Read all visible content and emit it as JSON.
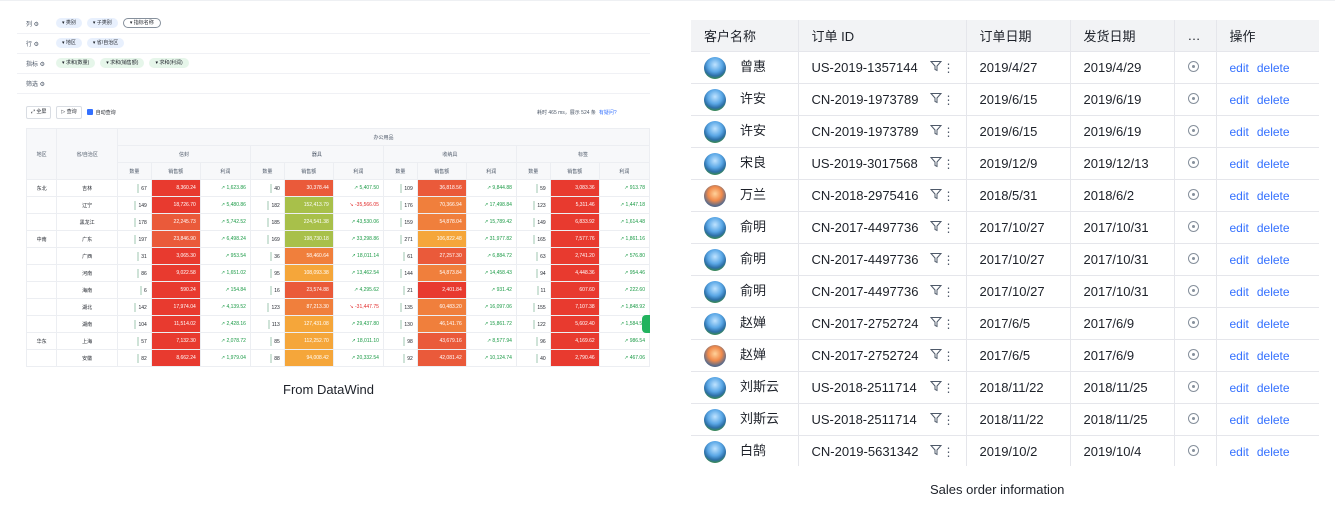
{
  "left_panel": {
    "config_rows": [
      {
        "label": "列 ⚙",
        "pills": [
          {
            "text": "▾ 类别",
            "style": "blue"
          },
          {
            "text": "▾ 子类别",
            "style": "blue"
          },
          {
            "text": "▾ 指标名称",
            "style": "outline"
          }
        ]
      },
      {
        "label": "行 ⚙",
        "pills": [
          {
            "text": "▾ 地区",
            "style": "blue"
          },
          {
            "text": "▾ 省/自治区",
            "style": "blue"
          }
        ]
      },
      {
        "label": "指标 ⚙",
        "pills": [
          {
            "text": "▾ 求和(数量)",
            "style": "green"
          },
          {
            "text": "▾ 求和(销售额)",
            "style": "green"
          },
          {
            "text": "▾ 求和(利润)",
            "style": "green"
          }
        ]
      },
      {
        "label": "筛选 ⚙",
        "pills": []
      }
    ],
    "toolbar": {
      "fullscreen_label": "⤢ 全屏",
      "query_label": "▷ 查询",
      "auto_query_label": "自动查询",
      "status_text": "耗时 465 ms，展示 524 条",
      "help_link": "有疑问?"
    },
    "pivot": {
      "top_header": "办公用品",
      "row_headers": [
        "地区",
        "省/自治区"
      ],
      "subcategories": [
        "信封",
        "器具",
        "收纳具",
        "标签"
      ],
      "metrics": [
        "数量",
        "销售额",
        "利润"
      ],
      "rows": [
        {
          "region": "东北",
          "province": "吉林",
          "cells": [
            [
              "67",
              "8,360.24",
              "↗ 1,623.86"
            ],
            [
              "40",
              "30,378.44",
              "↗ 5,407.50"
            ],
            [
              "109",
              "36,818.56",
              "↗ 9,844.88"
            ],
            [
              "59",
              "3,083.36",
              "↗ 913.78"
            ]
          ]
        },
        {
          "region": "",
          "province": "辽宁",
          "cells": [
            [
              "149",
              "18,726.70",
              "↗ 5,480.86"
            ],
            [
              "182",
              "152,413.79",
              "↘ -35,566.05"
            ],
            [
              "176",
              "70,366.94",
              "↗ 17,498.84"
            ],
            [
              "123",
              "5,311.46",
              "↗ 1,447.18"
            ]
          ]
        },
        {
          "region": "",
          "province": "黑龙江",
          "cells": [
            [
              "178",
              "22,245.73",
              "↗ 5,742.52"
            ],
            [
              "185",
              "224,541.38",
              "↗ 43,530.06"
            ],
            [
              "159",
              "54,878.04",
              "↗ 15,789.42"
            ],
            [
              "149",
              "6,833.92",
              "↗ 1,614.48"
            ]
          ]
        },
        {
          "region": "中南",
          "province": "广东",
          "cells": [
            [
              "197",
              "23,846.90",
              "↗ 6,498.24"
            ],
            [
              "169",
              "198,730.18",
              "↗ 33,298.86"
            ],
            [
              "271",
              "106,822.48",
              "↗ 31,977.82"
            ],
            [
              "165",
              "7,577.76",
              "↗ 1,861.16"
            ]
          ]
        },
        {
          "region": "",
          "province": "广西",
          "cells": [
            [
              "31",
              "3,065.30",
              "↗ 953.54"
            ],
            [
              "36",
              "58,460.64",
              "↗ 18,011.14"
            ],
            [
              "61",
              "27,257.30",
              "↗ 6,884.72"
            ],
            [
              "63",
              "2,741.20",
              "↗ 576.80"
            ]
          ]
        },
        {
          "region": "",
          "province": "河南",
          "cells": [
            [
              "86",
              "9,022.58",
              "↗ 1,651.02"
            ],
            [
              "95",
              "108,093.38",
              "↗ 13,462.54"
            ],
            [
              "144",
              "54,873.84",
              "↗ 14,458.43"
            ],
            [
              "94",
              "4,448.36",
              "↗ 954.46"
            ]
          ]
        },
        {
          "region": "",
          "province": "海南",
          "cells": [
            [
              "6",
              "590.24",
              "↗ 154.84"
            ],
            [
              "16",
              "23,574.88",
              "↗ 4,295.62"
            ],
            [
              "21",
              "2,401.84",
              "↗ 931.42"
            ],
            [
              "11",
              "607.60",
              "↗ 222.60"
            ]
          ]
        },
        {
          "region": "",
          "province": "湖北",
          "cells": [
            [
              "142",
              "17,974.04",
              "↗ 4,139.52"
            ],
            [
              "123",
              "87,213.30",
              "↘ -31,447.75"
            ],
            [
              "135",
              "60,483.20",
              "↗ 16,097.06"
            ],
            [
              "155",
              "7,107.38",
              "↗ 1,848.92"
            ]
          ]
        },
        {
          "region": "",
          "province": "湖南",
          "cells": [
            [
              "104",
              "11,514.02",
              "↗ 2,428.16"
            ],
            [
              "113",
              "127,431.08",
              "↗ 29,437.80"
            ],
            [
              "130",
              "46,141.76",
              "↗ 15,861.72"
            ],
            [
              "122",
              "5,602.40",
              "↗ 1,584.52"
            ]
          ]
        },
        {
          "region": "华东",
          "province": "上海",
          "cells": [
            [
              "57",
              "7,132.30",
              "↗ 2,078.72"
            ],
            [
              "85",
              "112,252.70",
              "↗ 18,011.10"
            ],
            [
              "98",
              "43,679.16",
              "↗ 8,577.94"
            ],
            [
              "96",
              "4,169.62",
              "↗ 986.54"
            ]
          ]
        },
        {
          "region": "",
          "province": "安徽",
          "cells": [
            [
              "82",
              "8,662.24",
              "↗ 1,979.04"
            ],
            [
              "88",
              "94,008.42",
              "↗ 20,332.54"
            ],
            [
              "92",
              "42,081.42",
              "↗ 10,124.74"
            ],
            [
              "40",
              "2,790.46",
              "↗ 467.06"
            ]
          ]
        }
      ]
    },
    "caption": "From DataWind"
  },
  "right_panel": {
    "columns": [
      "客户名称",
      "订单 ID",
      "订单日期",
      "发货日期",
      "…",
      "操作"
    ],
    "rows": [
      {
        "name": "曾惠",
        "order_id": "US-2019-1357144",
        "order_date": "2019/4/27",
        "ship_date": "2019/4/29",
        "avatar": "sky"
      },
      {
        "name": "许安",
        "order_id": "CN-2019-1973789",
        "order_date": "2019/6/15",
        "ship_date": "2019/6/19",
        "avatar": "sky"
      },
      {
        "name": "许安",
        "order_id": "CN-2019-1973789",
        "order_date": "2019/6/15",
        "ship_date": "2019/6/19",
        "avatar": "sky"
      },
      {
        "name": "宋良",
        "order_id": "US-2019-3017568",
        "order_date": "2019/12/9",
        "ship_date": "2019/12/13",
        "avatar": "sky"
      },
      {
        "name": "万兰",
        "order_id": "CN-2018-2975416",
        "order_date": "2018/5/31",
        "ship_date": "2018/6/2",
        "avatar": "sunset"
      },
      {
        "name": "俞明",
        "order_id": "CN-2017-4497736",
        "order_date": "2017/10/27",
        "ship_date": "2017/10/31",
        "avatar": "sky"
      },
      {
        "name": "俞明",
        "order_id": "CN-2017-4497736",
        "order_date": "2017/10/27",
        "ship_date": "2017/10/31",
        "avatar": "sky"
      },
      {
        "name": "俞明",
        "order_id": "CN-2017-4497736",
        "order_date": "2017/10/27",
        "ship_date": "2017/10/31",
        "avatar": "sky"
      },
      {
        "name": "赵婵",
        "order_id": "CN-2017-2752724",
        "order_date": "2017/6/5",
        "ship_date": "2017/6/9",
        "avatar": "sky"
      },
      {
        "name": "赵婵",
        "order_id": "CN-2017-2752724",
        "order_date": "2017/6/5",
        "ship_date": "2017/6/9",
        "avatar": "sunset"
      },
      {
        "name": "刘斯云",
        "order_id": "US-2018-2511714",
        "order_date": "2018/11/22",
        "ship_date": "2018/11/25",
        "avatar": "sky"
      },
      {
        "name": "刘斯云",
        "order_id": "US-2018-2511714",
        "order_date": "2018/11/22",
        "ship_date": "2018/11/25",
        "avatar": "sky"
      },
      {
        "name": "白鹄",
        "order_id": "CN-2019-5631342",
        "order_date": "2019/10/2",
        "ship_date": "2019/10/4",
        "avatar": "sky"
      }
    ],
    "filter_icon": "filter-icon",
    "more_icon": "⋮",
    "edit_label": "edit",
    "delete_label": "delete",
    "caption": "Sales order information"
  },
  "colors": {
    "accent": "#3370ff",
    "header_bg": "#f2f3f5",
    "profit_up": "#1a9a45",
    "profit_down": "#e22b2b"
  }
}
